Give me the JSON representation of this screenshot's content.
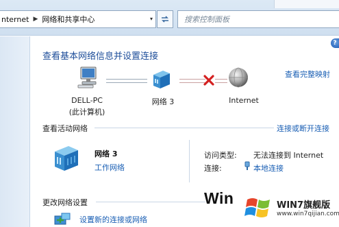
{
  "address_bar": {
    "crumbs": [
      "nternet",
      "网络和共享中心"
    ],
    "separator": "▶",
    "dropdown_glyph": "▾",
    "refresh_glyph": "⇆"
  },
  "search": {
    "placeholder": "搜索控制面板"
  },
  "help": {
    "glyph": "?"
  },
  "page": {
    "title": "查看基本网络信息并设置连接",
    "full_map_link": "查看完整映射"
  },
  "network_map": {
    "pc_name": "DELL-PC",
    "pc_sub": "(此计算机)",
    "network_name": "网络  3",
    "internet_name": "Internet",
    "status": "disconnected"
  },
  "active_networks": {
    "header": "查看活动网络",
    "connect_link": "连接或断开连接",
    "network_name": "网络  3",
    "network_type": "工作网络",
    "access_type_label": "访问类型:",
    "access_type_value": "无法连接到 Internet",
    "connection_label": "连接:",
    "connection_value": "本地连接"
  },
  "change_settings": {
    "header": "更改网络设置",
    "setup_link": "设置新的连接或网络"
  },
  "watermark": {
    "win_text": "Win",
    "brand": "WIN7旗舰版",
    "url": "www.win7qijian.com"
  },
  "colors": {
    "link": "#1a5fb4",
    "title": "#1e4e9a",
    "error_x": "#d42020"
  }
}
